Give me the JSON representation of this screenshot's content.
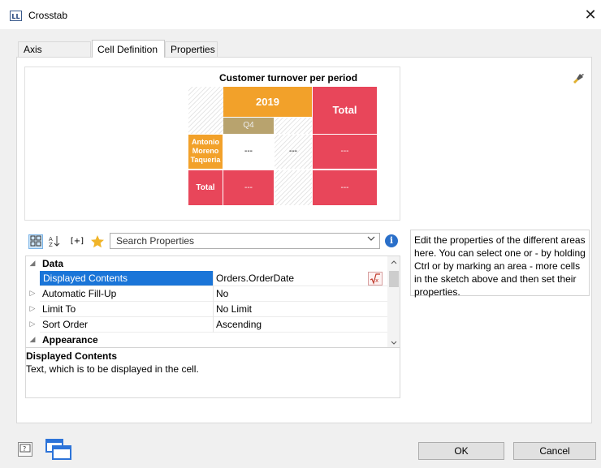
{
  "window": {
    "title": "Crosstab",
    "app_icon": "LL",
    "close_glyph": "✕"
  },
  "tabs": [
    {
      "label": "Axis Definition",
      "active": false
    },
    {
      "label": "Cell Definition",
      "active": true
    },
    {
      "label": "Properties",
      "active": false
    }
  ],
  "sketch": {
    "title": "Customer turnover per period",
    "col_header": "2019",
    "col_total": "Total",
    "col_sub": "Q4",
    "row_header": "Antonio Moreno Taqueria",
    "row_total": "Total",
    "placeholder": "---",
    "colors": {
      "orange": "#f2a12a",
      "red": "#e8465a",
      "tan": "#b8a36e"
    }
  },
  "toolbar": {
    "icons": [
      "categorized-view-icon",
      "sort-az-icon",
      "expand-all-icon",
      "favorites-star-icon"
    ],
    "expand_label": "[+]",
    "search_placeholder": "Search Properties"
  },
  "properties": {
    "categories": [
      {
        "label": "Data",
        "expanded": true
      },
      {
        "label": "Appearance",
        "expanded": true
      }
    ],
    "rows": [
      {
        "name": "Displayed Contents",
        "value": "Orders.OrderDate",
        "selected": true
      },
      {
        "name": "Automatic Fill-Up",
        "value": "No",
        "selected": false
      },
      {
        "name": "Limit To",
        "value": "No Limit",
        "selected": false
      },
      {
        "name": "Sort Order",
        "value": "Ascending",
        "selected": false
      }
    ]
  },
  "help": {
    "title": "Displayed Contents",
    "text": "Text, which is to be displayed in the cell."
  },
  "description": "Edit the properties of the different areas here. You can select one or - by holding Ctrl or by marking an area - more cells in the sketch above and then set their properties.",
  "buttons": {
    "ok": "OK",
    "cancel": "Cancel"
  }
}
